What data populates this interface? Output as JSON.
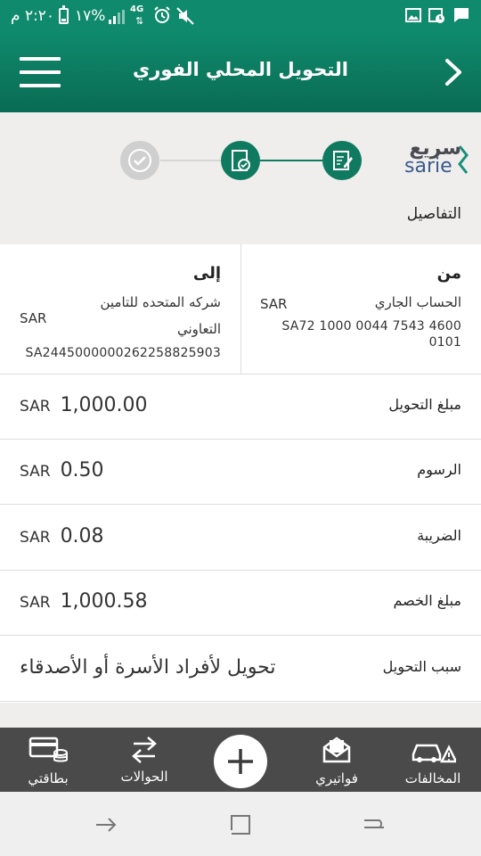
{
  "status_bar": {
    "time": "٢:٢٠ م",
    "battery": "%١٧",
    "network": "4G"
  },
  "header": {
    "title": "التحويل المحلي الفوري"
  },
  "brand": {
    "name_ar": "سريع",
    "name_en": "sarie"
  },
  "stepper": {
    "section_label": "التفاصيل"
  },
  "transfer": {
    "from": {
      "heading": "من",
      "account_name": "الحساب الجاري",
      "currency": "SAR",
      "iban_line1": "SA72 1000 0044 7543 4600",
      "iban_line2": "0101"
    },
    "to": {
      "heading": "إلى",
      "account_name_line1": "شركه المتحده للتامين",
      "account_name_line2": "التعاوني",
      "currency": "SAR",
      "iban": "SA2445000000262258825903"
    },
    "rows": [
      {
        "label": "مبلغ التحويل",
        "currency": "SAR",
        "amount": "1,000.00"
      },
      {
        "label": "الرسوم",
        "currency": "SAR",
        "amount": "0.50"
      },
      {
        "label": "الضريبة",
        "currency": "SAR",
        "amount": "0.08"
      },
      {
        "label": "مبلغ الخصم",
        "currency": "SAR",
        "amount": "1,000.58"
      }
    ],
    "reason": {
      "label": "سبب التحويل",
      "value": "تحويل لأفراد الأسرة أو الأصدقاء"
    }
  },
  "bottom_nav": {
    "cards": "بطاقتي",
    "transfers": "الحوالات",
    "bills": "فواتيري",
    "violations": "المخالفات"
  }
}
